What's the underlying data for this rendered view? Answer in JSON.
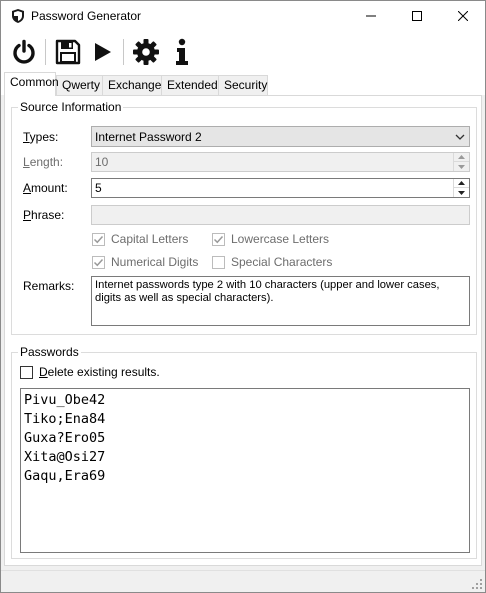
{
  "window": {
    "title": "Password Generator"
  },
  "toolbar": {
    "buttons": [
      {
        "name": "power-icon",
        "title": "Exit"
      },
      {
        "name": "save-icon",
        "title": "Save"
      },
      {
        "name": "play-icon",
        "title": "Generate"
      },
      {
        "name": "gear-icon",
        "title": "Settings"
      },
      {
        "name": "info-icon",
        "title": "About"
      }
    ]
  },
  "tabs": [
    "Common",
    "Qwerty",
    "Exchange",
    "Extended",
    "Security"
  ],
  "active_tab": "Common",
  "source": {
    "group_title": "Source Information",
    "types_label": "Types:",
    "types_value": "Internet Password 2",
    "length_label": "Length:",
    "length_value": "10",
    "amount_label": "Amount:",
    "amount_value": "5",
    "phrase_label": "Phrase:",
    "phrase_value": "",
    "checkboxes": {
      "capital": {
        "label": "Capital Letters",
        "checked": true,
        "enabled": false
      },
      "lowercase": {
        "label": "Lowercase Letters",
        "checked": true,
        "enabled": false
      },
      "numerical": {
        "label": "Numerical Digits",
        "checked": true,
        "enabled": false
      },
      "special": {
        "label": "Special Characters",
        "checked": false,
        "enabled": false
      }
    },
    "remarks_label": "Remarks:",
    "remarks_text": "Internet passwords type 2 with 10 characters (upper and lower cases, digits as well as special characters)."
  },
  "passwords": {
    "group_title": "Passwords",
    "delete_label": "Delete existing results.",
    "delete_checked": false,
    "items": [
      "Pivu_Obe42",
      "Tiko;Ena84",
      "Guxa?Ero05",
      "Xita@Osi27",
      "Gaqu,Era69"
    ]
  },
  "colors": {
    "window_bg": "#f0f0f0",
    "panel_bg": "#ffffff",
    "disabled_text": "#6d6d6d",
    "check_disabled": "#9a9a9a"
  }
}
